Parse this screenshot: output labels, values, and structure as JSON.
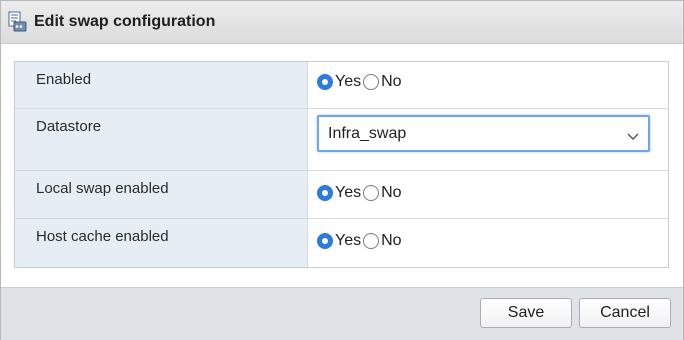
{
  "dialog": {
    "title": "Edit swap configuration",
    "icon": "swap-config-icon"
  },
  "rows": [
    {
      "label": "Enabled",
      "type": "radio",
      "options": [
        "Yes",
        "No"
      ],
      "selected": "Yes"
    },
    {
      "label": "Datastore",
      "type": "select",
      "value": "Infra_swap"
    },
    {
      "label": "Local swap enabled",
      "type": "radio",
      "options": [
        "Yes",
        "No"
      ],
      "selected": "Yes"
    },
    {
      "label": "Host cache enabled",
      "type": "radio",
      "options": [
        "Yes",
        "No"
      ],
      "selected": "Yes"
    }
  ],
  "footer": {
    "save_label": "Save",
    "cancel_label": "Cancel"
  },
  "colors": {
    "accent": "#2d7be0",
    "label_background": "#e6edf5",
    "footer_background": "#dfe3e8"
  }
}
